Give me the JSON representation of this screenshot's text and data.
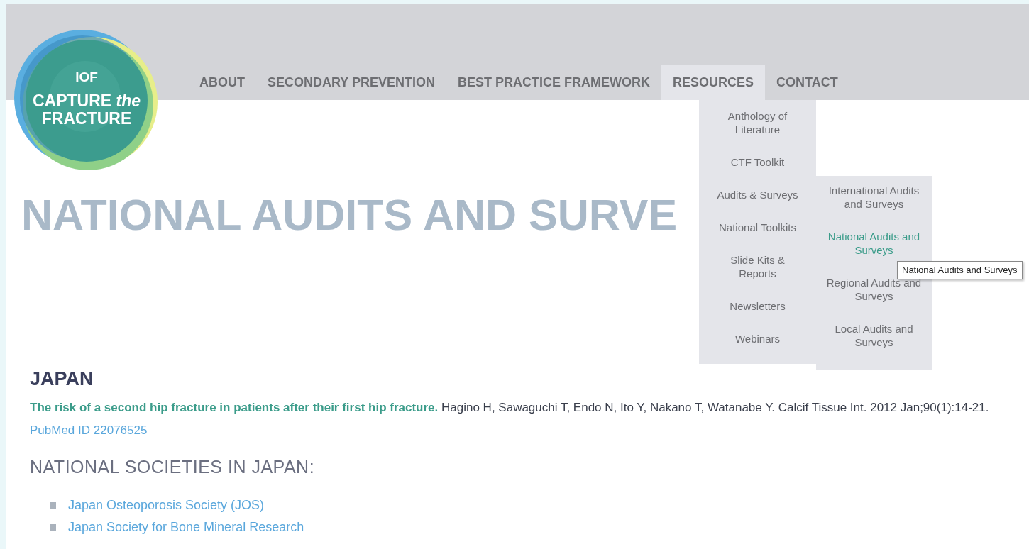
{
  "logo": {
    "lines": [
      "IOF",
      "CAPTURE *the*",
      "FRACTURE"
    ]
  },
  "nav": [
    {
      "label": "ABOUT",
      "selected": false
    },
    {
      "label": "SECONDARY PREVENTION",
      "selected": false
    },
    {
      "label": "BEST PRACTICE FRAMEWORK",
      "selected": false
    },
    {
      "label": "RESOURCES",
      "selected": true
    },
    {
      "label": "CONTACT",
      "selected": false
    }
  ],
  "dropdown": [
    {
      "label": "Anthology of Literature"
    },
    {
      "label": "CTF Toolkit"
    },
    {
      "label": "Audits & Surveys",
      "children": [
        {
          "label": "International Audits and Surveys",
          "selected": false
        },
        {
          "label": "National Audits and Surveys",
          "selected": true
        },
        {
          "label": "Regional Audits and Surveys",
          "selected": false
        },
        {
          "label": "Local Audits and Surveys",
          "selected": false
        }
      ]
    },
    {
      "label": "National Toolkits"
    },
    {
      "label": "Slide Kits & Reports"
    },
    {
      "label": "Newsletters"
    },
    {
      "label": "Webinars"
    }
  ],
  "tooltip": "National Audits and Surveys",
  "page_title": "NATIONAL AUDITS AND SURVE",
  "section": {
    "heading": "JAPAN",
    "article_title": "The risk of a second hip fracture in patients after their first hip fracture.",
    "citation": "Hagino H, Sawaguchi T, Endo N, Ito Y, Nakano T, Watanabe Y. Calcif Tissue Int. 2012 Jan;90(1):14-21.",
    "pubmed_link": "PubMed ID 22076525",
    "societies_heading": "NATIONAL SOCIETIES IN JAPAN:",
    "societies": [
      "Japan Osteoporosis Society (JOS)",
      "Japan Society for Bone Mineral Research"
    ]
  }
}
